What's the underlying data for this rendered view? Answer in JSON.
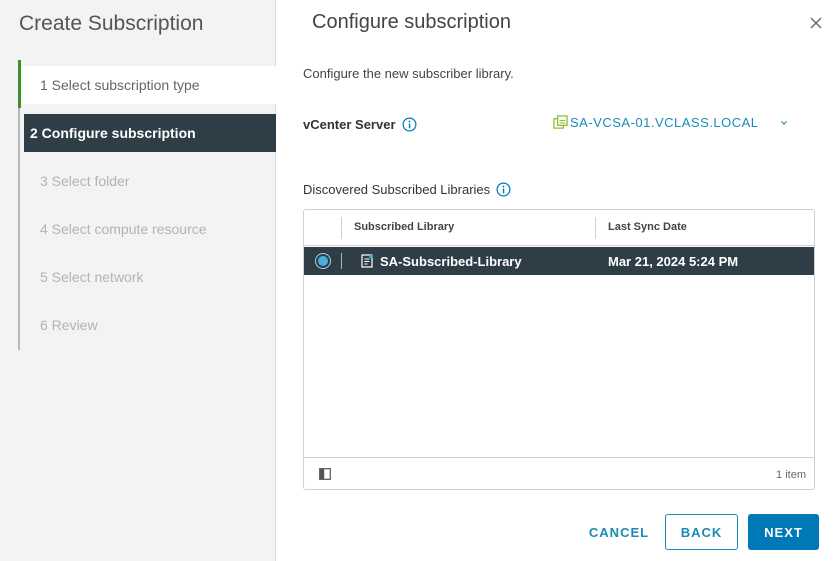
{
  "sidebar": {
    "title": "Create Subscription",
    "steps": [
      {
        "label": "1  Select subscription type",
        "state": "done"
      },
      {
        "label": "2  Configure subscription",
        "state": "active"
      },
      {
        "label": "3  Select folder",
        "state": "pending"
      },
      {
        "label": "4  Select compute resource",
        "state": "pending"
      },
      {
        "label": "5  Select network",
        "state": "pending"
      },
      {
        "label": "6  Review",
        "state": "pending"
      }
    ]
  },
  "main": {
    "title": "Configure subscription",
    "description": "Configure the new subscriber library.",
    "vcenter": {
      "label": "vCenter Server",
      "value": "SA-VCSA-01.VCLASS.LOCAL"
    },
    "libraries": {
      "label": "Discovered Subscribed Libraries",
      "columns": [
        "Subscribed Library",
        "Last Sync Date"
      ],
      "rows": [
        {
          "library": "SA-Subscribed-Library",
          "last_sync": "Mar 21, 2024 5:24 PM",
          "selected": true
        }
      ],
      "count": "1 item"
    }
  },
  "footer": {
    "cancel": "CANCEL",
    "back": "BACK",
    "next": "NEXT"
  },
  "colors": {
    "active_step_bg": "#2f3d47",
    "accent": "#0079b8",
    "link": "#1a8bb6",
    "done_marker": "#3f8f2b"
  }
}
